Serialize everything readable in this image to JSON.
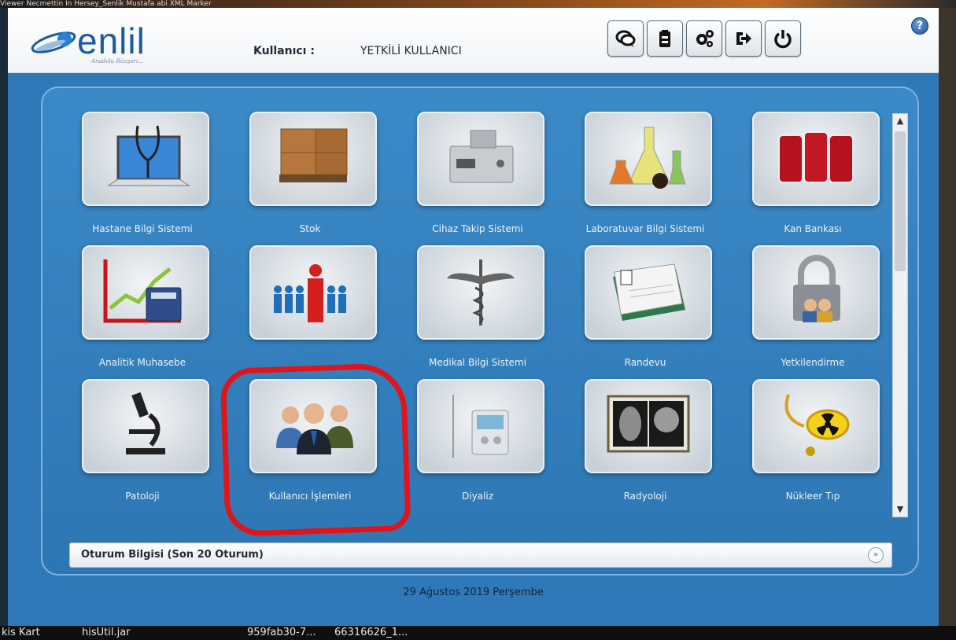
{
  "desktop": {
    "top_text": "Viewer   Necmettin In Hersey_Senlik   Mustafa abi                    XML Marker",
    "taskbar": [
      "kis Kart",
      "hisUtil.jar",
      "959fab30-7...",
      "66316626_1..."
    ]
  },
  "header": {
    "logo": "enlil",
    "logo_sub": "Anadolu Rüzgarı...",
    "user_label": "Kullanıcı :",
    "user_value": "YETKİLİ KULLANICI",
    "help": "?"
  },
  "toolbar": {
    "buttons": [
      "chat-icon",
      "clipboard-icon",
      "settings-icon",
      "logout-icon",
      "power-icon"
    ]
  },
  "modules": [
    {
      "label": "Hastane Bilgi Sistemi",
      "icon": "laptop-stethoscope-icon"
    },
    {
      "label": "Stok",
      "icon": "boxes-icon"
    },
    {
      "label": "Cihaz Takip Sistemi",
      "icon": "device-icon"
    },
    {
      "label": "Laboratuvar Bilgi Sistemi",
      "icon": "flasks-icon"
    },
    {
      "label": "Kan Bankası",
      "icon": "blood-bags-icon"
    },
    {
      "label": "Analitik Muhasebe",
      "icon": "chart-calculator-icon"
    },
    {
      "label": "",
      "icon": "people-leader-icon"
    },
    {
      "label": "Medikal Bilgi Sistemi",
      "icon": "caduceus-icon"
    },
    {
      "label": "Randevu",
      "icon": "calendar-icon"
    },
    {
      "label": "Yetkilendirme",
      "icon": "lock-users-icon"
    },
    {
      "label": "Patoloji",
      "icon": "microscope-icon"
    },
    {
      "label": "Kullanıcı İşlemleri",
      "icon": "users-icon"
    },
    {
      "label": "Diyaliz",
      "icon": "dialysis-machine-icon"
    },
    {
      "label": "Radyoloji",
      "icon": "xray-icon"
    },
    {
      "label": "Nükleer Tıp",
      "icon": "radiation-icon"
    }
  ],
  "session": {
    "title": "Oturum Bilgisi (Son 20 Oturum)"
  },
  "footer": {
    "date": "29 Ağustos 2019 Perşembe"
  }
}
